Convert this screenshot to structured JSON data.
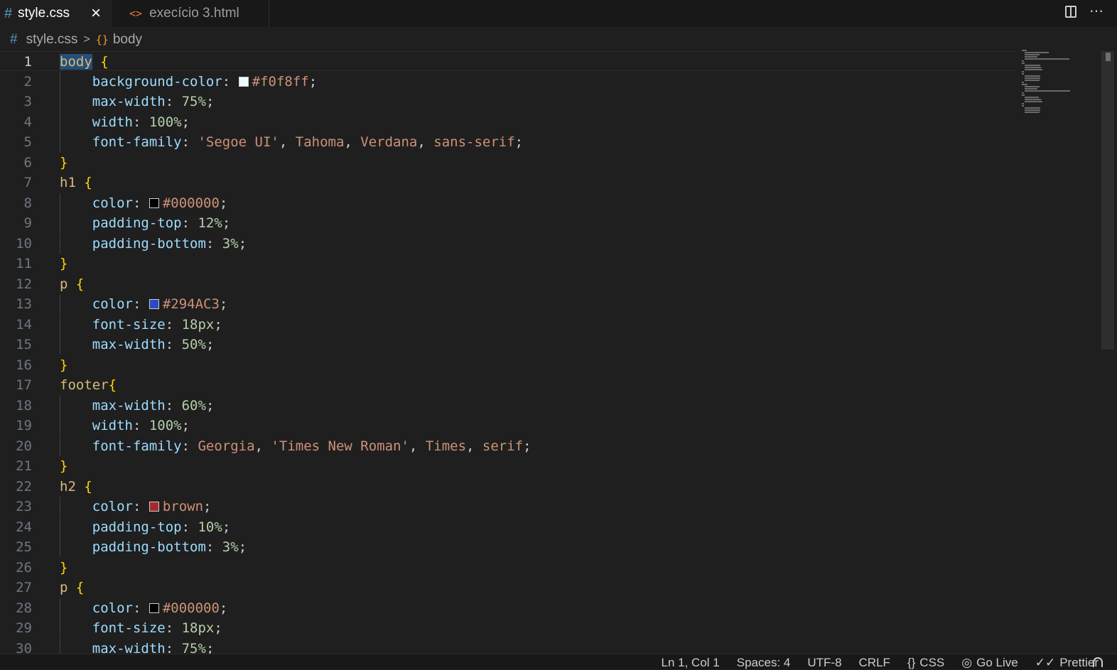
{
  "tabs": [
    {
      "label": "style.css",
      "icon": "#",
      "active": true
    },
    {
      "label": "execício 3.html",
      "icon": "<>",
      "active": false
    }
  ],
  "breadcrumb": {
    "file_icon": "#",
    "file": "style.css",
    "separator": ">",
    "symbol_icon": "{}",
    "symbol": "body"
  },
  "editor": {
    "cursor": {
      "line": 1,
      "col": 1
    },
    "lines": [
      {
        "n": "1",
        "indent": false,
        "tokens": [
          {
            "t": "body",
            "c": "sel selhl"
          },
          {
            "t": " ",
            "c": "punct"
          },
          {
            "t": "{",
            "c": "brace"
          }
        ]
      },
      {
        "n": "2",
        "indent": true,
        "tokens": [
          {
            "t": "    background-color",
            "c": "prop"
          },
          {
            "t": ": ",
            "c": "punct"
          },
          {
            "swatch": "#f0f8ff"
          },
          {
            "t": "#f0f8ff",
            "c": "str"
          },
          {
            "t": ";",
            "c": "punct"
          }
        ]
      },
      {
        "n": "3",
        "indent": true,
        "tokens": [
          {
            "t": "    max-width",
            "c": "prop"
          },
          {
            "t": ": ",
            "c": "punct"
          },
          {
            "t": "75%",
            "c": "num"
          },
          {
            "t": ";",
            "c": "punct"
          }
        ]
      },
      {
        "n": "4",
        "indent": true,
        "tokens": [
          {
            "t": "    width",
            "c": "prop"
          },
          {
            "t": ": ",
            "c": "punct"
          },
          {
            "t": "100%",
            "c": "num"
          },
          {
            "t": ";",
            "c": "punct"
          }
        ]
      },
      {
        "n": "5",
        "indent": true,
        "tokens": [
          {
            "t": "    font-family",
            "c": "prop"
          },
          {
            "t": ": ",
            "c": "punct"
          },
          {
            "t": "'Segoe UI'",
            "c": "str"
          },
          {
            "t": ", ",
            "c": "punct"
          },
          {
            "t": "Tahoma",
            "c": "str"
          },
          {
            "t": ", ",
            "c": "punct"
          },
          {
            "t": "Verdana",
            "c": "str"
          },
          {
            "t": ", ",
            "c": "punct"
          },
          {
            "t": "sans-serif",
            "c": "str"
          },
          {
            "t": ";",
            "c": "punct"
          }
        ]
      },
      {
        "n": "6",
        "indent": false,
        "tokens": [
          {
            "t": "}",
            "c": "brace"
          }
        ]
      },
      {
        "n": "7",
        "indent": false,
        "tokens": [
          {
            "t": "h1",
            "c": "sel"
          },
          {
            "t": " ",
            "c": "punct"
          },
          {
            "t": "{",
            "c": "brace"
          }
        ]
      },
      {
        "n": "8",
        "indent": true,
        "tokens": [
          {
            "t": "    color",
            "c": "prop"
          },
          {
            "t": ": ",
            "c": "punct"
          },
          {
            "swatch": "#000000"
          },
          {
            "t": "#000000",
            "c": "str"
          },
          {
            "t": ";",
            "c": "punct"
          }
        ]
      },
      {
        "n": "9",
        "indent": true,
        "tokens": [
          {
            "t": "    padding-top",
            "c": "prop"
          },
          {
            "t": ": ",
            "c": "punct"
          },
          {
            "t": "12%",
            "c": "num"
          },
          {
            "t": ";",
            "c": "punct"
          }
        ]
      },
      {
        "n": "10",
        "indent": true,
        "tokens": [
          {
            "t": "    padding-bottom",
            "c": "prop"
          },
          {
            "t": ": ",
            "c": "punct"
          },
          {
            "t": "3%",
            "c": "num"
          },
          {
            "t": ";",
            "c": "punct"
          }
        ]
      },
      {
        "n": "11",
        "indent": false,
        "tokens": [
          {
            "t": "}",
            "c": "brace"
          }
        ]
      },
      {
        "n": "12",
        "indent": false,
        "tokens": [
          {
            "t": "p",
            "c": "sel"
          },
          {
            "t": " ",
            "c": "punct"
          },
          {
            "t": "{",
            "c": "brace"
          }
        ]
      },
      {
        "n": "13",
        "indent": true,
        "tokens": [
          {
            "t": "    color",
            "c": "prop"
          },
          {
            "t": ": ",
            "c": "punct"
          },
          {
            "swatch": "#294AC3"
          },
          {
            "t": "#294AC3",
            "c": "str"
          },
          {
            "t": ";",
            "c": "punct"
          }
        ]
      },
      {
        "n": "14",
        "indent": true,
        "tokens": [
          {
            "t": "    font-size",
            "c": "prop"
          },
          {
            "t": ": ",
            "c": "punct"
          },
          {
            "t": "18px",
            "c": "num"
          },
          {
            "t": ";",
            "c": "punct"
          }
        ]
      },
      {
        "n": "15",
        "indent": true,
        "tokens": [
          {
            "t": "    max-width",
            "c": "prop"
          },
          {
            "t": ": ",
            "c": "punct"
          },
          {
            "t": "50%",
            "c": "num"
          },
          {
            "t": ";",
            "c": "punct"
          }
        ]
      },
      {
        "n": "16",
        "indent": false,
        "tokens": [
          {
            "t": "}",
            "c": "brace"
          }
        ]
      },
      {
        "n": "17",
        "indent": false,
        "tokens": [
          {
            "t": "footer",
            "c": "sel"
          },
          {
            "t": "{",
            "c": "brace"
          }
        ]
      },
      {
        "n": "18",
        "indent": true,
        "tokens": [
          {
            "t": "    max-width",
            "c": "prop"
          },
          {
            "t": ": ",
            "c": "punct"
          },
          {
            "t": "60%",
            "c": "num"
          },
          {
            "t": ";",
            "c": "punct"
          }
        ]
      },
      {
        "n": "19",
        "indent": true,
        "tokens": [
          {
            "t": "    width",
            "c": "prop"
          },
          {
            "t": ": ",
            "c": "punct"
          },
          {
            "t": "100%",
            "c": "num"
          },
          {
            "t": ";",
            "c": "punct"
          }
        ]
      },
      {
        "n": "20",
        "indent": true,
        "tokens": [
          {
            "t": "    font-family",
            "c": "prop"
          },
          {
            "t": ": ",
            "c": "punct"
          },
          {
            "t": "Georgia",
            "c": "str"
          },
          {
            "t": ", ",
            "c": "punct"
          },
          {
            "t": "'Times New Roman'",
            "c": "str"
          },
          {
            "t": ", ",
            "c": "punct"
          },
          {
            "t": "Times",
            "c": "str"
          },
          {
            "t": ", ",
            "c": "punct"
          },
          {
            "t": "serif",
            "c": "str"
          },
          {
            "t": ";",
            "c": "punct"
          }
        ]
      },
      {
        "n": "21",
        "indent": false,
        "tokens": [
          {
            "t": "}",
            "c": "brace"
          }
        ]
      },
      {
        "n": "22",
        "indent": false,
        "tokens": [
          {
            "t": "h2",
            "c": "sel"
          },
          {
            "t": " ",
            "c": "punct"
          },
          {
            "t": "{",
            "c": "brace"
          }
        ]
      },
      {
        "n": "23",
        "indent": true,
        "tokens": [
          {
            "t": "    color",
            "c": "prop"
          },
          {
            "t": ": ",
            "c": "punct"
          },
          {
            "swatch": "#a52a2a"
          },
          {
            "t": "brown",
            "c": "str"
          },
          {
            "t": ";",
            "c": "punct"
          }
        ]
      },
      {
        "n": "24",
        "indent": true,
        "tokens": [
          {
            "t": "    padding-top",
            "c": "prop"
          },
          {
            "t": ": ",
            "c": "punct"
          },
          {
            "t": "10%",
            "c": "num"
          },
          {
            "t": ";",
            "c": "punct"
          }
        ]
      },
      {
        "n": "25",
        "indent": true,
        "tokens": [
          {
            "t": "    padding-bottom",
            "c": "prop"
          },
          {
            "t": ": ",
            "c": "punct"
          },
          {
            "t": "3%",
            "c": "num"
          },
          {
            "t": ";",
            "c": "punct"
          }
        ]
      },
      {
        "n": "26",
        "indent": false,
        "tokens": [
          {
            "t": "}",
            "c": "brace"
          }
        ]
      },
      {
        "n": "27",
        "indent": false,
        "tokens": [
          {
            "t": "p",
            "c": "sel"
          },
          {
            "t": " ",
            "c": "punct"
          },
          {
            "t": "{",
            "c": "brace"
          }
        ]
      },
      {
        "n": "28",
        "indent": true,
        "tokens": [
          {
            "t": "    color",
            "c": "prop"
          },
          {
            "t": ": ",
            "c": "punct"
          },
          {
            "swatch": "#000000"
          },
          {
            "t": "#000000",
            "c": "str"
          },
          {
            "t": ";",
            "c": "punct"
          }
        ]
      },
      {
        "n": "29",
        "indent": true,
        "tokens": [
          {
            "t": "    font-size",
            "c": "prop"
          },
          {
            "t": ": ",
            "c": "punct"
          },
          {
            "t": "18px",
            "c": "num"
          },
          {
            "t": ";",
            "c": "punct"
          }
        ]
      },
      {
        "n": "30",
        "indent": true,
        "tokens": [
          {
            "t": "    max-width",
            "c": "prop"
          },
          {
            "t": ": ",
            "c": "punct"
          },
          {
            "t": "75%",
            "c": "num"
          },
          {
            "t": ";",
            "c": "punct"
          }
        ]
      }
    ]
  },
  "statusbar": {
    "position": "Ln 1, Col 1",
    "spaces": "Spaces: 4",
    "encoding": "UTF-8",
    "eol": "CRLF",
    "language": "CSS",
    "golive": "Go Live",
    "prettier": "Prettier"
  },
  "colors": {
    "background": "#1f1f1f",
    "selector": "#d7ba7d",
    "property": "#9cdcfe",
    "string": "#ce9178",
    "number": "#b5cea8",
    "brace": "#ffd700"
  }
}
